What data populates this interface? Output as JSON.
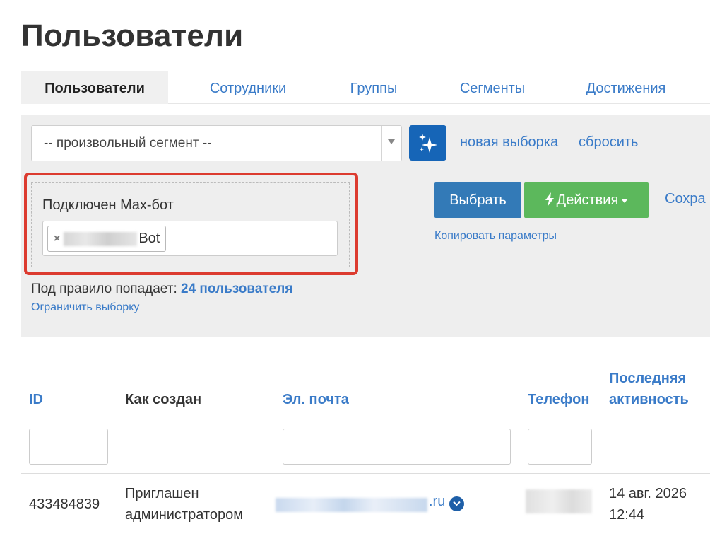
{
  "page": {
    "title": "Пользователи"
  },
  "tabs": [
    {
      "label": "Пользователи",
      "active": true
    },
    {
      "label": "Сотрудники",
      "active": false
    },
    {
      "label": "Группы",
      "active": false
    },
    {
      "label": "Сегменты",
      "active": false
    },
    {
      "label": "Достижения",
      "active": false
    }
  ],
  "filter": {
    "segment_select": {
      "value": "-- произвольный сегмент --"
    },
    "magic_icon": "sparkles-icon",
    "new_selection_label": "новая выборка",
    "reset_label": "сбросить",
    "rule": {
      "label": "Подключен Max-бот",
      "tag_remove": "×",
      "tag_suffix": "Bot"
    },
    "select_button_label": "Выбрать",
    "actions_button_label": "Действия",
    "actions_icon": "bolt-icon",
    "save_label": "Сохра",
    "copy_params_label": "Копировать параметры",
    "rule_count_prefix": "Под правило попадает: ",
    "rule_count_value": "24 пользователя",
    "limit_label": "Ограничить выборку"
  },
  "table": {
    "columns": {
      "id": "ID",
      "created": "Как создан",
      "email": "Эл. почта",
      "phone": "Телефон",
      "last_activity_line1": "Последняя",
      "last_activity_line2": "активность"
    },
    "rows": [
      {
        "id": "433484839",
        "created_line1": "Приглашен",
        "created_line2": "администратором",
        "email_domain": ".ru",
        "activity_line1": "14 авг. 2026",
        "activity_line2": "12:44"
      }
    ]
  },
  "colors": {
    "link": "#3a7bc8",
    "primary": "#337ab7",
    "success": "#5cb85c",
    "highlight": "#dc3b2f",
    "magic": "#1665b7"
  }
}
